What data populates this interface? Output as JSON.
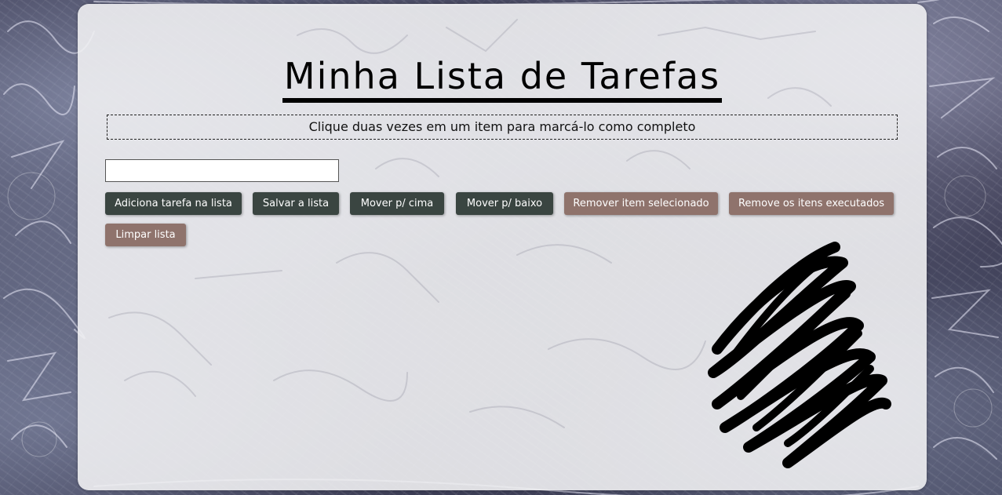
{
  "app": {
    "title": "Minha Lista de Tarefas",
    "hint": "Clique duas vezes em um item para marcá-lo como completo"
  },
  "form": {
    "task_input_value": "",
    "task_input_placeholder": ""
  },
  "buttons": {
    "add": "Adiciona tarefa na lista",
    "save": "Salvar a lista",
    "move_up": "Mover p/ cima",
    "move_down": "Mover p/ baixo",
    "remove_selected": "Remover item selecionado",
    "remove_completed": "Remove os itens executados",
    "clear": "Limpar lista"
  },
  "task_list": [],
  "colors": {
    "dark_button": "#3a4541",
    "mauve_button": "#8f736c",
    "panel": "#f0f0f2"
  },
  "icons": {
    "decoration": "black-scribble"
  }
}
